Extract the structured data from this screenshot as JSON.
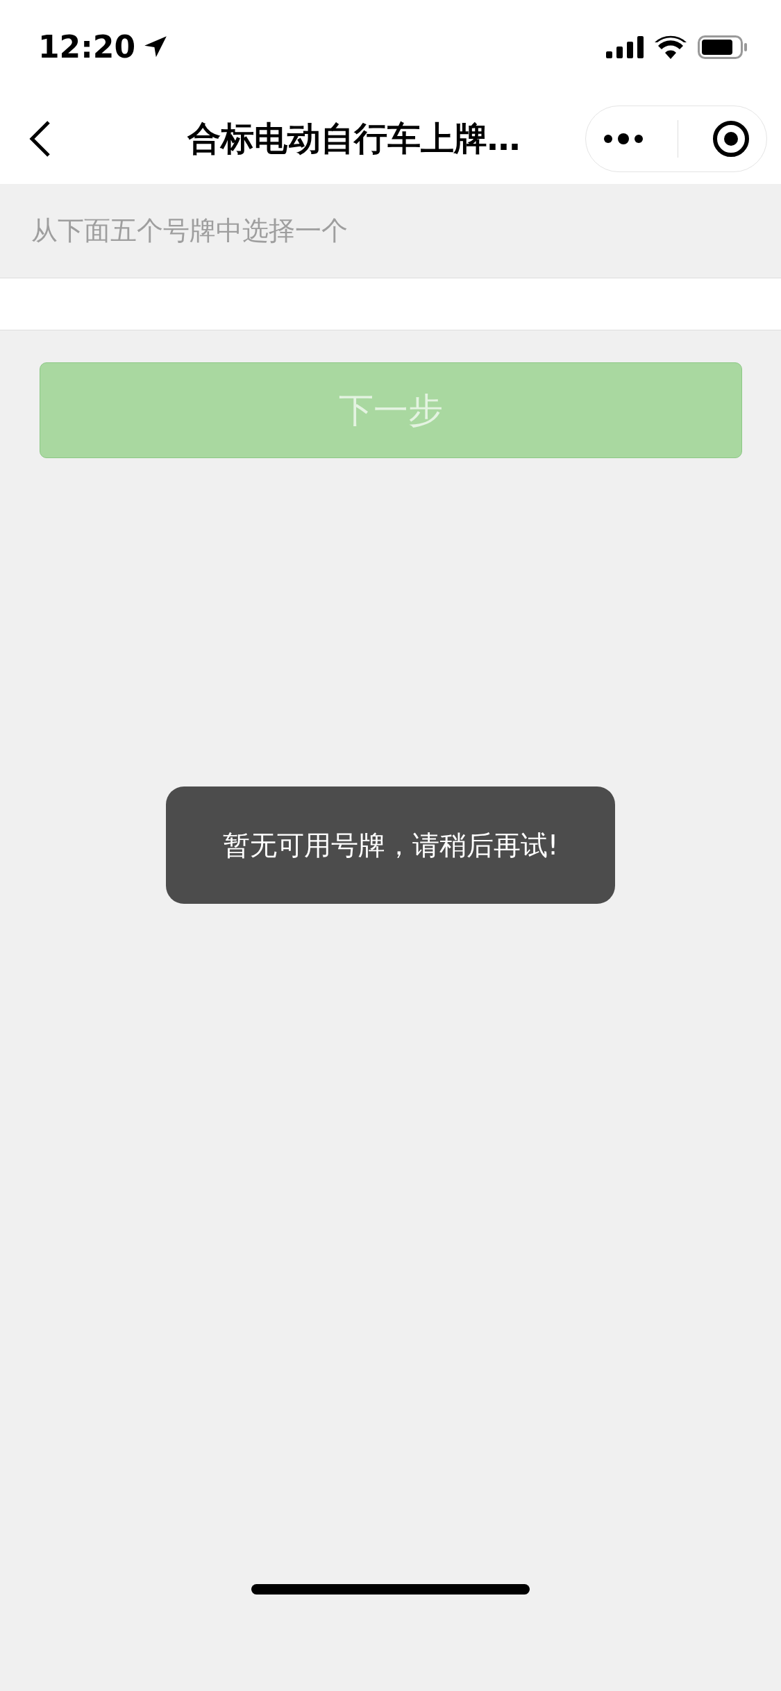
{
  "status_bar": {
    "time": "12:20"
  },
  "nav_bar": {
    "title": "合标电动自行车上牌…"
  },
  "form": {
    "hint": "从下面五个号牌中选择一个",
    "next_button": {
      "label": "下一步",
      "disabled": true
    }
  },
  "toast": {
    "message": "暂无可用号牌，请稍后再试!"
  }
}
